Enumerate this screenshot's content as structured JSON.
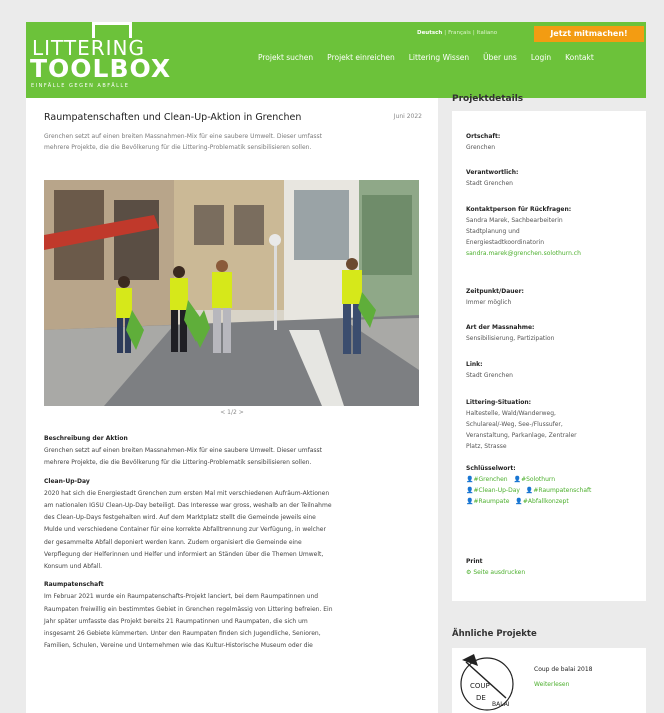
{
  "header": {
    "logo_line1": "LITTERING",
    "logo_line2": "TOOLBOX",
    "logo_tagline": "EINFÄLLE GEGEN ABFÄLLE",
    "lang_de": "Deutsch",
    "lang_fr": "Français",
    "lang_it": "Italiano",
    "cta_label": "Jetzt mitmachen!",
    "nav": [
      "Projekt suchen",
      "Projekt einreichen",
      "Littering Wissen",
      "Über uns",
      "Login",
      "Kontakt"
    ]
  },
  "article": {
    "title": "Raumpatenschaften und Clean-Up-Aktion in Grenchen",
    "date": "Juni 2022",
    "lead_line1": "Grenchen setzt auf einen breiten Massnahmen-Mix für eine saubere Umwelt. Dieser umfasst",
    "lead_line2": "mehrere Projekte, die die Bevölkerung für die Littering-Problematik sensibilisieren sollen.",
    "pager": "< 1/2 >",
    "sections": [
      {
        "heading": "Beschreibung der Aktion",
        "lines": [
          "Grenchen setzt auf einen breiten Massnahmen-Mix für eine saubere Umwelt. Dieser umfasst",
          "mehrere Projekte, die die Bevölkerung für die Littering-Problematik sensibilisieren sollen."
        ]
      },
      {
        "heading": "Clean-Up-Day",
        "lines": [
          "2020 hat sich die Energiestadt Grenchen zum ersten Mal mit verschiedenen Aufräum-Aktionen",
          "am nationalen IGSU Clean-Up-Day beteiligt. Das Interesse war gross, weshalb an der Teilnahme",
          "des Clean-Up-Days festgehalten wird. Auf dem Marktplatz stellt die Gemeinde jeweils eine",
          "Mulde und verschiedene Container für eine korrekte Abfalltrennung zur Verfügung, in welcher",
          "der gesammelte Abfall deponiert werden kann. Zudem organisiert die Gemeinde eine",
          "Verpflegung der Helferinnen und Helfer und informiert an Ständen über die Themen Umwelt,",
          "Konsum und Abfall."
        ]
      },
      {
        "heading": "Raumpatenschaft",
        "lines": [
          "Im Februar 2021 wurde ein Raumpatenschafts-Projekt lanciert, bei dem Raumpatinnen und",
          "Raumpaten freiwillig ein bestimmtes Gebiet in Grenchen regelmässig von Littering befreien. Ein",
          "Jahr später umfasste das Projekt bereits 21 Raumpatinnen und Raumpaten, die sich um",
          "insgesamt 26 Gebiete kümmerten. Unter den Raumpaten finden sich Jugendliche, Senioren,",
          "Familien, Schulen, Vereine und Unternehmen wie das Kultur-Historische Museum oder die"
        ]
      }
    ]
  },
  "sidebar": {
    "heading": "Projektdetails",
    "ortschaft_label": "Ortschaft:",
    "ortschaft": "Grenchen",
    "verantwortlich_label": "Verantwortlich:",
    "verantwortlich": "Stadt Grenchen",
    "kontakt_label": "Kontaktperson für Rückfragen:",
    "kontakt_line1": "Sandra Marek, Sachbearbeiterin",
    "kontakt_line2": "Stadtplanung und",
    "kontakt_line3": "Energiestadtkoordinatorin",
    "kontakt_email": "sandra.marek@grenchen.solothurn.ch",
    "zeit_label": "Zeitpunkt/Dauer:",
    "zeit": "Immer möglich",
    "art_label": "Art der Massnahme:",
    "art": "Sensibilisierung, Partizipation",
    "link_label": "Link:",
    "link": "Stadt Grenchen",
    "situation_label": "Littering-Situation:",
    "situation_line1": "Haltestelle, Wald/Wanderweg,",
    "situation_line2": "Schulareal/-Weg, See-/Flussufer,",
    "situation_line3": "Veranstaltung, Parkanlage, Zentraler",
    "situation_line4": "Platz, Strasse",
    "tags_label": "Schlüsselwort:",
    "tags": [
      "#Grenchen",
      "#Solothurn",
      "#Clean-Up-Day",
      "#Raumpatenschaft",
      "#Raumpate",
      "#Abfallkonzept"
    ],
    "print_label": "Print",
    "print_link": "Seite ausdrucken",
    "similar_heading": "Ähnliche Projekte",
    "similar_title": "Coup de balai 2018",
    "similar_more": "Weiterlesen"
  },
  "colors": {
    "brand_green": "#6cc23a",
    "cta_orange": "#f39c12",
    "link_green": "#4caf2d"
  }
}
